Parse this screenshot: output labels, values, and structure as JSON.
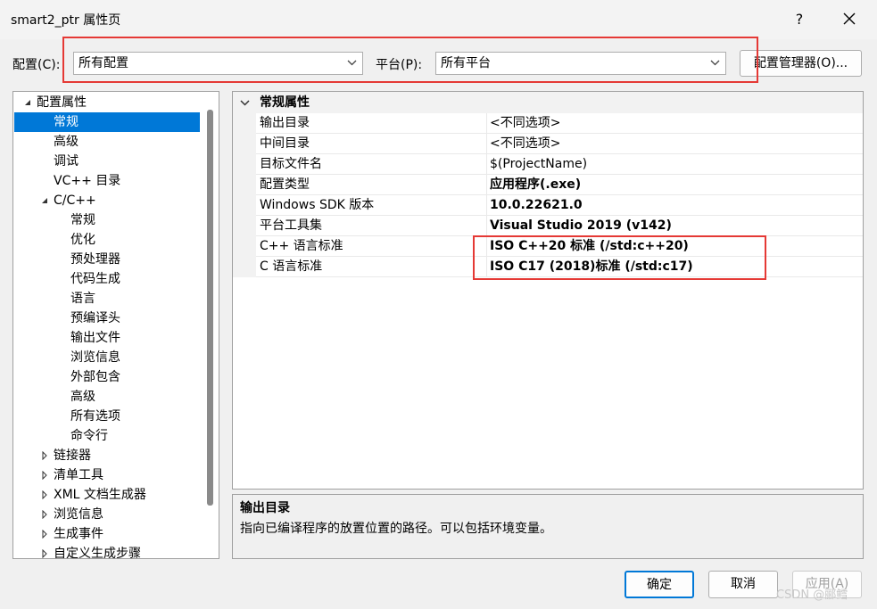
{
  "window": {
    "title": "smart2_ptr 属性页",
    "help": "?"
  },
  "toolbar": {
    "config_label": "配置(C):",
    "config_value": "所有配置",
    "platform_label": "平台(P):",
    "platform_value": "所有平台",
    "config_manager_label": "配置管理器(O)..."
  },
  "tree": {
    "items": [
      {
        "label": "配置属性",
        "indent": 0,
        "expander": "expanded"
      },
      {
        "label": "常规",
        "indent": 1,
        "expander": "none",
        "selected": true
      },
      {
        "label": "高级",
        "indent": 1,
        "expander": "none"
      },
      {
        "label": "调试",
        "indent": 1,
        "expander": "none"
      },
      {
        "label": "VC++ 目录",
        "indent": 1,
        "expander": "none"
      },
      {
        "label": "C/C++",
        "indent": 1,
        "expander": "expanded"
      },
      {
        "label": "常规",
        "indent": 2,
        "expander": "none"
      },
      {
        "label": "优化",
        "indent": 2,
        "expander": "none"
      },
      {
        "label": "预处理器",
        "indent": 2,
        "expander": "none"
      },
      {
        "label": "代码生成",
        "indent": 2,
        "expander": "none"
      },
      {
        "label": "语言",
        "indent": 2,
        "expander": "none"
      },
      {
        "label": "预编译头",
        "indent": 2,
        "expander": "none"
      },
      {
        "label": "输出文件",
        "indent": 2,
        "expander": "none"
      },
      {
        "label": "浏览信息",
        "indent": 2,
        "expander": "none"
      },
      {
        "label": "外部包含",
        "indent": 2,
        "expander": "none"
      },
      {
        "label": "高级",
        "indent": 2,
        "expander": "none"
      },
      {
        "label": "所有选项",
        "indent": 2,
        "expander": "none"
      },
      {
        "label": "命令行",
        "indent": 2,
        "expander": "none"
      },
      {
        "label": "链接器",
        "indent": 1,
        "expander": "collapsed"
      },
      {
        "label": "清单工具",
        "indent": 1,
        "expander": "collapsed"
      },
      {
        "label": "XML 文档生成器",
        "indent": 1,
        "expander": "collapsed"
      },
      {
        "label": "浏览信息",
        "indent": 1,
        "expander": "collapsed"
      },
      {
        "label": "生成事件",
        "indent": 1,
        "expander": "collapsed"
      },
      {
        "label": "自定义生成步骤",
        "indent": 1,
        "expander": "collapsed"
      }
    ]
  },
  "grid": {
    "category": "常规属性",
    "rows": [
      {
        "name": "输出目录",
        "value": "<不同选项>",
        "bold": false
      },
      {
        "name": "中间目录",
        "value": "<不同选项>",
        "bold": false
      },
      {
        "name": "目标文件名",
        "value": "$(ProjectName)",
        "bold": false
      },
      {
        "name": "配置类型",
        "value": "应用程序(.exe)",
        "bold": true
      },
      {
        "name": "Windows SDK 版本",
        "value": "10.0.22621.0",
        "bold": true
      },
      {
        "name": "平台工具集",
        "value": "Visual Studio 2019 (v142)",
        "bold": true
      },
      {
        "name": "C++ 语言标准",
        "value": "ISO C++20 标准 (/std:c++20)",
        "bold": true
      },
      {
        "name": "C 语言标准",
        "value": "ISO C17 (2018)标准 (/std:c17)",
        "bold": true
      }
    ]
  },
  "description": {
    "title": "输出目录",
    "text": "指向已编译程序的放置位置的路径。可以包括环境变量。"
  },
  "buttons": {
    "ok": "确定",
    "cancel": "取消",
    "apply": "应用(A)"
  },
  "watermark": "CSDN @郦鳕",
  "colors": {
    "selection": "#0078d7",
    "highlight_box": "#e53935"
  }
}
